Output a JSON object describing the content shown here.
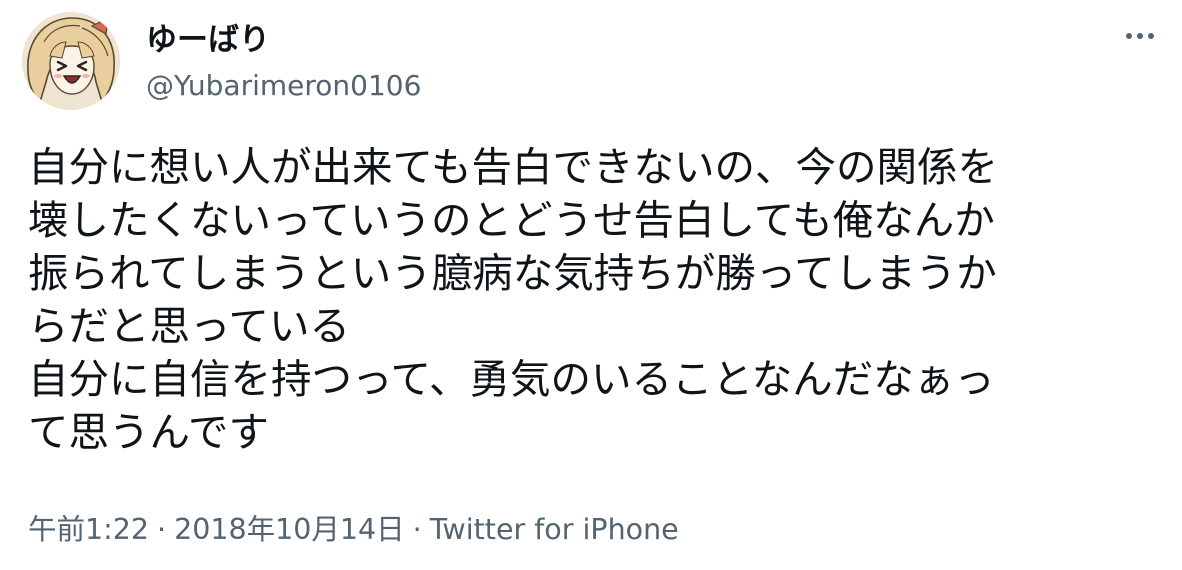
{
  "user": {
    "display_name": "ゆーばり",
    "handle": "@Yubarimeron0106"
  },
  "tweet": {
    "lines": [
      "自分に想い人が出来ても告白できないの、今の関係を",
      "壊したくないっていうのとどうせ告白しても俺なんか",
      "振られてしまうという臆病な気持ちが勝ってしまうか",
      "らだと思っている",
      "自分に自信を持つって、勇気のいることなんだなぁっ",
      "て思うんです"
    ],
    "time": "午前1:22",
    "separator": "·",
    "date": "2018年10月14日",
    "source": "Twitter for iPhone"
  },
  "colors": {
    "text_primary": "#0f1419",
    "text_secondary": "#536471"
  },
  "icons": {
    "more": "more-horizontal-icon",
    "avatar": "anime-character-avatar"
  }
}
